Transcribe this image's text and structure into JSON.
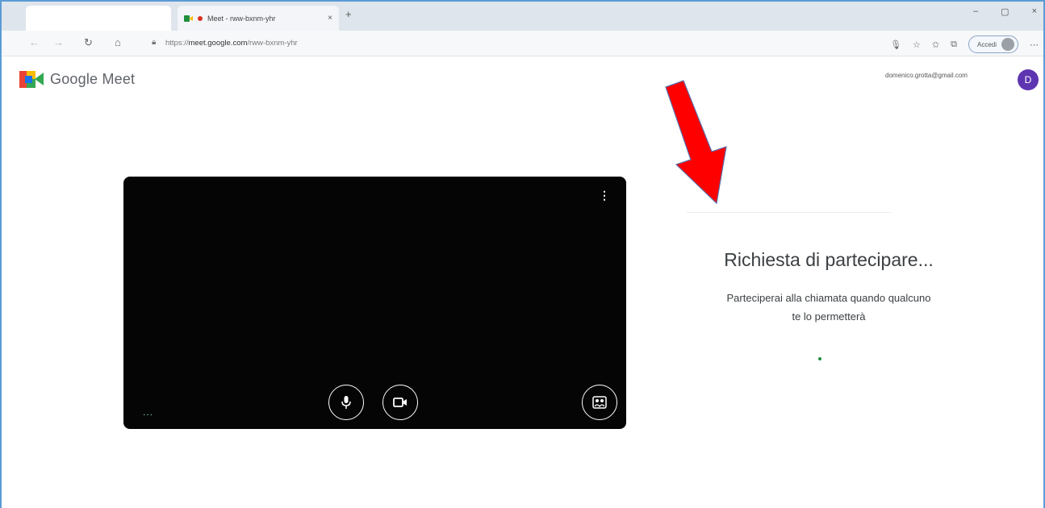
{
  "browser": {
    "tab_title": "Meet - rww-bxnm-yhr",
    "tab_close": "×",
    "new_tab": "+",
    "url_prefix": "https://",
    "url_host": "meet.google.com",
    "url_path": "/rww-bxnm-yhr",
    "signin_label": "Accedi",
    "window_controls": [
      "–",
      "▢",
      "×"
    ]
  },
  "header": {
    "app_name": "Google Meet",
    "account_email": "domenico.grotta@gmail.com",
    "account_initial": "D"
  },
  "panel": {
    "title": "Richiesta di partecipare...",
    "subtitle_line1": "Parteciperai alla chiamata quando qualcuno",
    "subtitle_line2": "te lo permetterà"
  },
  "video": {
    "more_label": "⋮",
    "dots_label": "..."
  },
  "colors": {
    "accent": "#5b9bd5",
    "avatar": "#5e35b1",
    "annotation_arrow": "#ff0000"
  },
  "icons": {
    "mic": "microphone-icon",
    "camera": "camera-icon",
    "effects": "visual-effects-icon"
  }
}
